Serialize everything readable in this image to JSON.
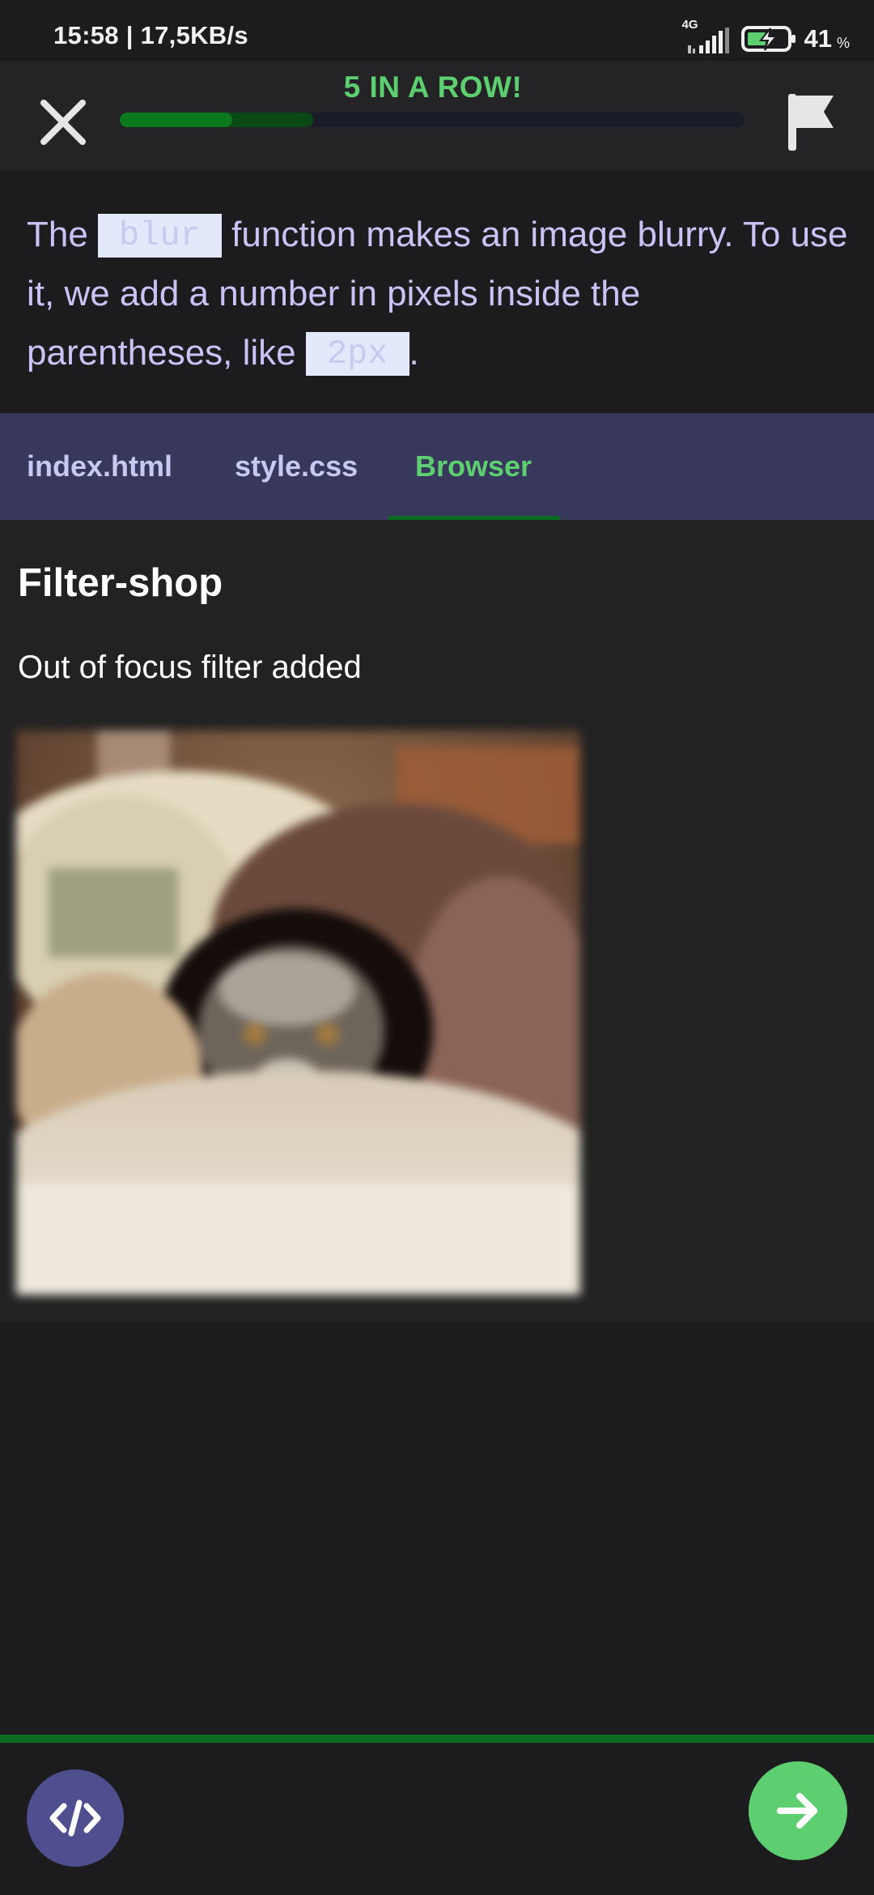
{
  "status_bar": {
    "time_speed": "15:58 | 17,5KB/s",
    "network_label": "4G",
    "battery_percent": "41",
    "battery_unit": "%",
    "icons": [
      "signal-icon",
      "battery-charging-icon"
    ]
  },
  "header": {
    "streak_text": "5 IN A ROW!",
    "progress": {
      "filled_fraction": 0.18,
      "light_fraction": 0.31
    },
    "icons": [
      "close-icon",
      "flag-icon"
    ]
  },
  "lesson": {
    "part1": "The ",
    "code1": "blur",
    "part2": " function makes an image blurry. To use it, we add a number in pixels inside the parentheses, like ",
    "code2": "2px",
    "part3": "."
  },
  "tabs": [
    {
      "label": "index.html",
      "active": false
    },
    {
      "label": "style.css",
      "active": false
    },
    {
      "label": "Browser",
      "active": true
    }
  ],
  "browser": {
    "heading": "Filter-shop",
    "text": "Out of focus filter added",
    "image_subject": "blurred cat under blanket"
  },
  "bottom": {
    "icons": [
      "code-icon",
      "arrow-right-icon"
    ]
  },
  "colors": {
    "accent_green": "#5dcf71",
    "text_lavender": "#c9c4f5",
    "tab_bar": "#37385c",
    "code_button": "#4f4f8f",
    "progress_green": "#0b7a1f"
  }
}
